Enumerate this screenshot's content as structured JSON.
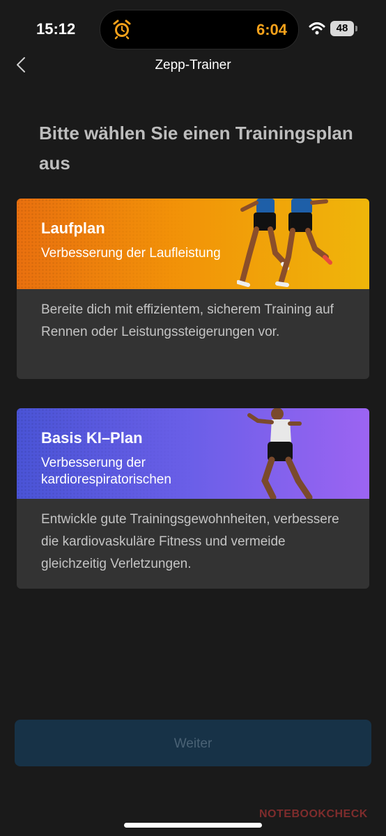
{
  "status_bar": {
    "time": "15:12",
    "timer": "6:04",
    "battery": "48",
    "icons": [
      "alarm-clock-icon",
      "wifi-icon",
      "battery-icon"
    ]
  },
  "nav": {
    "title": "Zepp-Trainer",
    "back_icon": "chevron-left-icon"
  },
  "heading": "Bitte wählen Sie einen Trainingsplan aus",
  "plans": [
    {
      "title": "Laufplan",
      "subtitle": "Verbesserung der Laufleistung",
      "description": "Bereite dich mit effizientem, sicherem Training auf Rennen oder Leistungssteigerungen vor.",
      "accent": "#f29208"
    },
    {
      "title": "Basis KI–Plan",
      "subtitle": "Verbesserung der kardiorespiratorischen",
      "description": "Entwickle gute Trainingsgewohnheiten, verbessere die kardiovaskuläre Fitness und vermeide gleichzeitig Verletzungen.",
      "accent": "#6b5fe8"
    }
  ],
  "continue_label": "Weiter",
  "watermark": "NOTEBOOKCHECK"
}
